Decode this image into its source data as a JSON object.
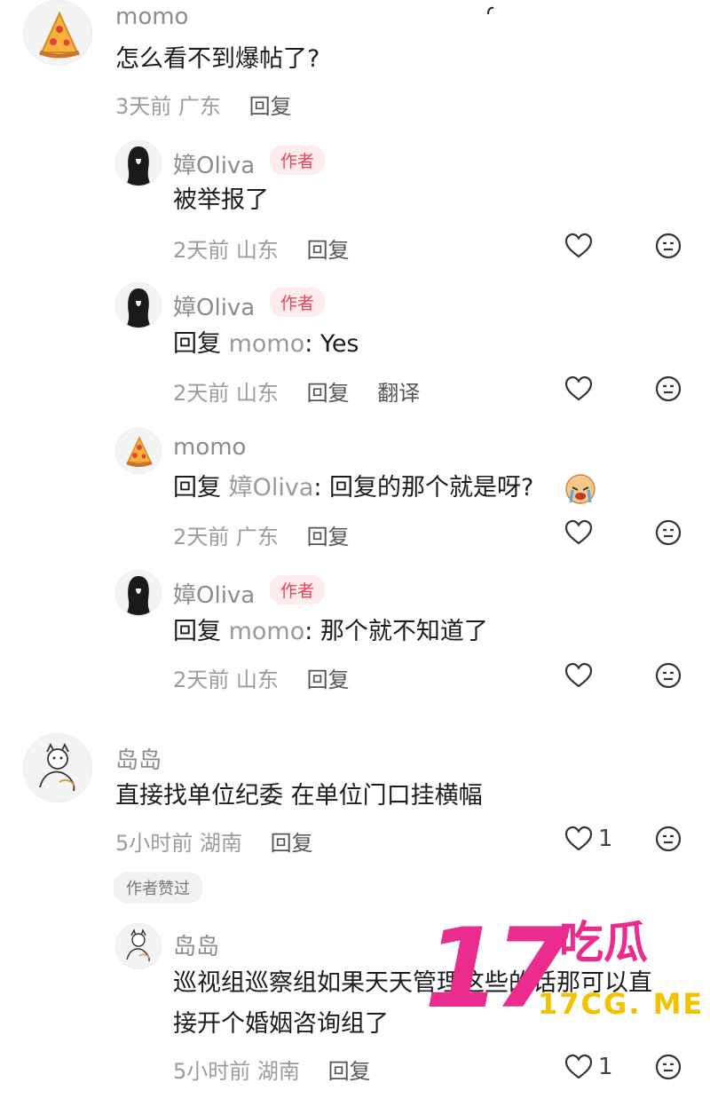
{
  "comments": [
    {
      "name": "momo",
      "text": "怎么看不到爆帖了?",
      "time": "3天前",
      "loc": "广东",
      "reply": "回复"
    },
    {
      "name": "嫜Oliva",
      "badge": "作者",
      "text": "被举报了",
      "time": "2天前",
      "loc": "山东",
      "reply": "回复"
    },
    {
      "name": "嫜Oliva",
      "badge": "作者",
      "prefix": "回复 ",
      "mention": "momo",
      "text": ": Yes",
      "time": "2天前",
      "loc": "山东",
      "reply": "回复",
      "translate": "翻译"
    },
    {
      "name": "momo",
      "prefix": "回复 ",
      "mention": "嫜Oliva",
      "text": ": 回复的那个就是呀?",
      "time": "2天前",
      "loc": "广东",
      "reply": "回复"
    },
    {
      "name": "嫜Oliva",
      "badge": "作者",
      "prefix": "回复 ",
      "mention": "momo",
      "text": ": 那个就不知道了",
      "time": "2天前",
      "loc": "山东",
      "reply": "回复"
    },
    {
      "name": "岛岛",
      "text": "直接找单位纪委 在单位门口挂横幅",
      "time": "5小时前",
      "loc": "湖南",
      "reply": "回复",
      "likes": "1",
      "tag": "作者赞过"
    },
    {
      "name": "岛岛",
      "text": "巡视组巡察组如果天天管理这些的话那可以直",
      "text2": "接开个婚姻咨询组了",
      "time": "5小时前",
      "loc": "湖南",
      "reply": "回复",
      "likes": "1"
    }
  ],
  "watermark": {
    "number": "17",
    "chinese": "吃瓜",
    "url": "17CG. ME"
  },
  "colors": {
    "author_badge": "#e64555",
    "watermark_pink": "#ec2b8e",
    "watermark_yellow": "#f2c200"
  }
}
